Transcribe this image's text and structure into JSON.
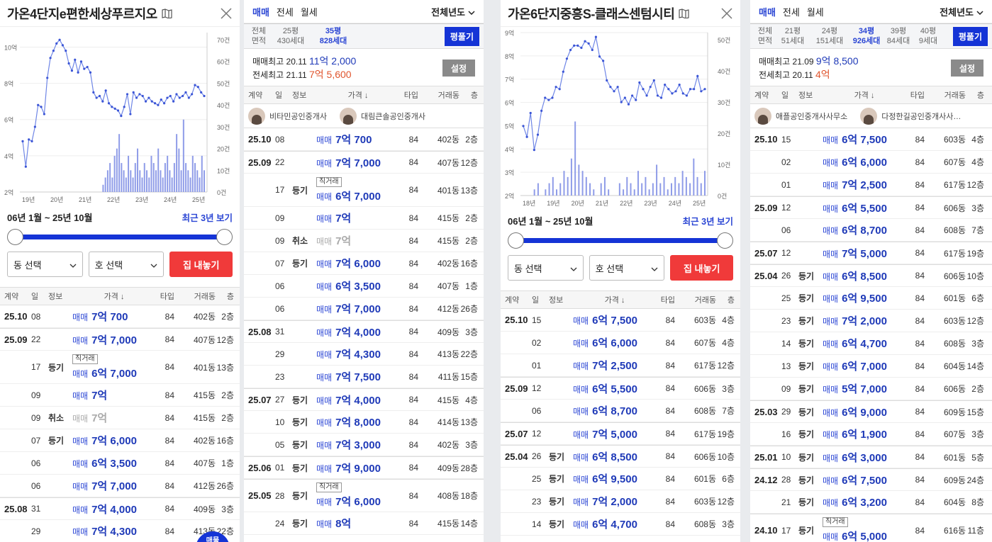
{
  "p1": {
    "title": "가온4단지e편한세상푸르지오",
    "chart_data": {
      "type": "line",
      "x_ticks": [
        "19년",
        "20년",
        "21년",
        "22년",
        "23년",
        "24년",
        "25년"
      ],
      "y_left_ticks": [
        "10억",
        "8억",
        "6억",
        "4억",
        "2억"
      ],
      "y_right_ticks": [
        "70건",
        "60건",
        "50건",
        "40건",
        "30건",
        "20건",
        "10건",
        "0건"
      ],
      "series": [
        {
          "values": [
            4.8,
            3.4,
            4.9,
            4.8,
            5.6,
            6.8,
            6.7,
            6.3,
            8.3,
            9.4,
            9.8,
            10.2,
            10.4,
            10.1,
            9.8,
            9.1,
            8.7,
            9.3,
            8.6,
            9.2,
            8.8,
            8.9,
            8.6,
            7.5,
            7.2,
            7.3,
            7.0,
            7.6,
            6.9,
            6.7,
            6.6,
            6.5,
            6.2,
            6.7,
            7.4,
            6.3,
            7.5,
            7.2,
            7.4,
            7.3,
            7.0,
            7.2,
            7.0,
            6.9,
            6.8,
            7.1,
            6.9,
            7.2,
            7.3,
            7.0,
            7.4,
            7.2,
            7.3,
            7.5,
            7.2,
            7.4,
            7.9,
            7.8,
            7.5,
            7.3
          ]
        },
        {
          "type": "bar",
          "values": [
            0,
            0,
            0,
            0,
            0,
            0,
            0,
            0,
            0,
            0,
            0,
            0,
            0,
            0,
            0,
            0,
            0,
            0,
            0,
            0,
            0,
            0,
            0,
            0,
            0,
            0,
            0,
            0,
            0,
            0,
            0,
            0,
            0,
            0,
            0,
            1,
            2,
            3,
            4,
            2,
            5,
            6,
            8,
            4,
            3,
            2,
            5,
            3,
            2,
            4,
            6,
            3,
            2,
            4,
            3,
            2,
            5,
            4,
            3,
            6,
            3,
            2,
            4,
            5,
            3,
            2,
            4,
            8,
            6,
            3,
            10,
            4,
            3,
            2,
            5,
            4,
            3,
            2,
            5,
            3
          ]
        }
      ],
      "ylim": [
        2,
        10.8
      ]
    },
    "range_label": "06년 1월 ~ 25년 10월",
    "recent_btn": "최근 3년 보기",
    "dong_select": "동 선택",
    "ho_select": "호 선택",
    "red_btn": "집 내놓기",
    "th": {
      "c1": "계약",
      "c2": "일",
      "c3": "정보",
      "c4": "가격",
      "c5": "타입",
      "c6": "거래동",
      "c7": "층"
    },
    "rows": [
      {
        "m": "25.10",
        "d": "08",
        "info": "",
        "tag": "",
        "k": "매매",
        "v": "7억 700",
        "t": "84",
        "dong": "402동",
        "f": "2층"
      },
      {
        "m": "25.09",
        "d": "22",
        "info": "",
        "tag": "",
        "k": "매매",
        "v": "7억 7,000",
        "t": "84",
        "dong": "407동",
        "f": "12층"
      },
      {
        "m": "",
        "d": "17",
        "info": "등기",
        "tag": "직거래",
        "k": "매매",
        "v": "6억 7,000",
        "t": "84",
        "dong": "401동",
        "f": "13층"
      },
      {
        "m": "",
        "d": "09",
        "info": "",
        "tag": "",
        "k": "매매",
        "v": "7억",
        "t": "84",
        "dong": "415동",
        "f": "2층"
      },
      {
        "m": "",
        "d": "09",
        "info": "취소",
        "tag": "",
        "k": "매매",
        "v": "7억",
        "t": "84",
        "dong": "415동",
        "f": "2층",
        "cancel": true
      },
      {
        "m": "",
        "d": "07",
        "info": "등기",
        "tag": "",
        "k": "매매",
        "v": "7억 6,000",
        "t": "84",
        "dong": "402동",
        "f": "16층"
      },
      {
        "m": "",
        "d": "06",
        "info": "",
        "tag": "",
        "k": "매매",
        "v": "6억 3,500",
        "t": "84",
        "dong": "407동",
        "f": "1층"
      },
      {
        "m": "",
        "d": "06",
        "info": "",
        "tag": "",
        "k": "매매",
        "v": "7억 7,000",
        "t": "84",
        "dong": "412동",
        "f": "26층"
      },
      {
        "m": "25.08",
        "d": "31",
        "info": "",
        "tag": "",
        "k": "매매",
        "v": "7억 4,000",
        "t": "84",
        "dong": "409동",
        "f": "3층"
      },
      {
        "m": "",
        "d": "29",
        "info": "",
        "tag": "",
        "k": "매매",
        "v": "7억 4,300",
        "t": "84",
        "dong": "413동",
        "f": "22층"
      }
    ],
    "fab": "매물"
  },
  "p2": {
    "tabs": [
      "매매",
      "전세",
      "월세"
    ],
    "year_sel": "전체년도",
    "areas": [
      {
        "a": "전체",
        "b": "면적"
      },
      {
        "a": "25평",
        "b": "430세대"
      },
      {
        "a": "35평",
        "b": "828세대",
        "on": true
      }
    ],
    "pyeong_btn": "평풀기",
    "sale_high_label": "매매최고",
    "sale_high_date": "20.11",
    "sale_high_val": "11억 2,000",
    "rent_high_label": "전세최고",
    "rent_high_date": "21.11",
    "rent_high_val": "7억 5,600",
    "setting_btn": "설정",
    "th": {
      "c1": "계약",
      "c2": "일",
      "c3": "정보",
      "c4": "가격",
      "c5": "타입",
      "c6": "거래동",
      "c7": "층"
    },
    "agents": [
      "비타민공인중개사",
      "대림큰솔공인중개사"
    ],
    "rows": [
      {
        "m": "25.10",
        "d": "08",
        "info": "",
        "tag": "",
        "k": "매매",
        "v": "7억 700",
        "t": "84",
        "dong": "402동",
        "f": "2층"
      },
      {
        "m": "25.09",
        "d": "22",
        "info": "",
        "tag": "",
        "k": "매매",
        "v": "7억 7,000",
        "t": "84",
        "dong": "407동",
        "f": "12층"
      },
      {
        "m": "",
        "d": "17",
        "info": "등기",
        "tag": "직거래",
        "k": "매매",
        "v": "6억 7,000",
        "t": "84",
        "dong": "401동",
        "f": "13층"
      },
      {
        "m": "",
        "d": "09",
        "info": "",
        "tag": "",
        "k": "매매",
        "v": "7억",
        "t": "84",
        "dong": "415동",
        "f": "2층"
      },
      {
        "m": "",
        "d": "09",
        "info": "취소",
        "tag": "",
        "k": "매매",
        "v": "7억",
        "t": "84",
        "dong": "415동",
        "f": "2층",
        "cancel": true
      },
      {
        "m": "",
        "d": "07",
        "info": "등기",
        "tag": "",
        "k": "매매",
        "v": "7억 6,000",
        "t": "84",
        "dong": "402동",
        "f": "16층"
      },
      {
        "m": "",
        "d": "06",
        "info": "",
        "tag": "",
        "k": "매매",
        "v": "6억 3,500",
        "t": "84",
        "dong": "407동",
        "f": "1층"
      },
      {
        "m": "",
        "d": "06",
        "info": "",
        "tag": "",
        "k": "매매",
        "v": "7억 7,000",
        "t": "84",
        "dong": "412동",
        "f": "26층"
      },
      {
        "m": "25.08",
        "d": "31",
        "info": "",
        "tag": "",
        "k": "매매",
        "v": "7억 4,000",
        "t": "84",
        "dong": "409동",
        "f": "3층"
      },
      {
        "m": "",
        "d": "29",
        "info": "",
        "tag": "",
        "k": "매매",
        "v": "7억 4,300",
        "t": "84",
        "dong": "413동",
        "f": "22층"
      },
      {
        "m": "",
        "d": "23",
        "info": "",
        "tag": "",
        "k": "매매",
        "v": "7억 7,500",
        "t": "84",
        "dong": "411동",
        "f": "15층"
      },
      {
        "m": "25.07",
        "d": "27",
        "info": "등기",
        "tag": "",
        "k": "매매",
        "v": "7억 4,000",
        "t": "84",
        "dong": "415동",
        "f": "4층"
      },
      {
        "m": "",
        "d": "10",
        "info": "등기",
        "tag": "",
        "k": "매매",
        "v": "7억 8,000",
        "t": "84",
        "dong": "414동",
        "f": "13층"
      },
      {
        "m": "",
        "d": "05",
        "info": "등기",
        "tag": "",
        "k": "매매",
        "v": "7억 3,000",
        "t": "84",
        "dong": "402동",
        "f": "3층"
      },
      {
        "m": "25.06",
        "d": "01",
        "info": "등기",
        "tag": "",
        "k": "매매",
        "v": "7억 9,000",
        "t": "84",
        "dong": "409동",
        "f": "28층"
      },
      {
        "m": "25.05",
        "d": "28",
        "info": "등기",
        "tag": "직거래",
        "k": "매매",
        "v": "7억 6,000",
        "t": "84",
        "dong": "408동",
        "f": "18층"
      },
      {
        "m": "",
        "d": "24",
        "info": "등기",
        "tag": "",
        "k": "매매",
        "v": "8억",
        "t": "84",
        "dong": "415동",
        "f": "14층"
      }
    ]
  },
  "p3": {
    "title": "가온6단지중흥S-클래스센텀시티",
    "chart_data": {
      "type": "line",
      "x_ticks": [
        "18년",
        "19년",
        "20년",
        "21년",
        "22년",
        "23년",
        "24년",
        "25년"
      ],
      "y_left_ticks": [
        "9억",
        "8억",
        "7억",
        "6억",
        "5억",
        "4억",
        "3억",
        "2억"
      ],
      "y_right_ticks": [
        "50건",
        "40건",
        "30건",
        "20건",
        "10건",
        "0건"
      ],
      "series": [
        {
          "values": [
            5.2,
            4.7,
            5.8,
            4.1,
            4.8,
            5.9,
            6.5,
            6.4,
            6.5,
            7.0,
            6.9,
            7.7,
            8.3,
            8.7,
            8.9,
            8.9,
            8.8,
            9.1,
            9.0,
            8.7,
            9.3,
            8.4,
            8.2,
            7.3,
            7.0,
            6.8,
            7.0,
            6.3,
            6.5,
            6.2,
            6.6,
            6.4,
            7.2,
            6.9,
            6.6,
            7.0,
            7.3,
            6.6,
            6.5,
            7.1,
            6.9,
            6.7,
            6.8,
            7.1,
            6.7,
            6.6,
            6.9,
            6.9,
            7.5,
            6.8,
            6.9
          ]
        },
        {
          "type": "bar",
          "values": [
            0,
            0,
            0,
            1,
            2,
            0,
            1,
            2,
            3,
            1,
            2,
            4,
            3,
            6,
            12,
            5,
            4,
            3,
            2,
            1,
            0,
            2,
            3,
            1,
            0,
            0,
            2,
            1,
            3,
            2,
            1,
            4,
            2,
            3,
            1,
            2,
            5,
            2,
            3,
            1,
            2,
            3,
            2,
            4,
            3,
            2,
            6,
            3,
            2,
            4
          ]
        }
      ],
      "ylim": [
        2,
        9.5
      ]
    },
    "range_label": "06년 1월 ~ 25년 10월",
    "recent_btn": "최근 3년 보기",
    "dong_select": "동 선택",
    "ho_select": "호 선택",
    "red_btn": "집 내놓기",
    "th": {
      "c1": "계약",
      "c2": "일",
      "c3": "정보",
      "c4": "가격",
      "c5": "타입",
      "c6": "거래동",
      "c7": "층"
    },
    "rows": [
      {
        "m": "25.10",
        "d": "15",
        "info": "",
        "tag": "",
        "k": "매매",
        "v": "6억 7,500",
        "t": "84",
        "dong": "603동",
        "f": "4층"
      },
      {
        "m": "",
        "d": "02",
        "info": "",
        "tag": "",
        "k": "매매",
        "v": "6억 6,000",
        "t": "84",
        "dong": "607동",
        "f": "4층"
      },
      {
        "m": "",
        "d": "01",
        "info": "",
        "tag": "",
        "k": "매매",
        "v": "7억 2,500",
        "t": "84",
        "dong": "617동",
        "f": "12층"
      },
      {
        "m": "25.09",
        "d": "12",
        "info": "",
        "tag": "",
        "k": "매매",
        "v": "6억 5,500",
        "t": "84",
        "dong": "606동",
        "f": "3층"
      },
      {
        "m": "",
        "d": "06",
        "info": "",
        "tag": "",
        "k": "매매",
        "v": "6억 8,700",
        "t": "84",
        "dong": "608동",
        "f": "7층"
      },
      {
        "m": "25.07",
        "d": "12",
        "info": "",
        "tag": "",
        "k": "매매",
        "v": "7억 5,000",
        "t": "84",
        "dong": "617동",
        "f": "19층"
      },
      {
        "m": "25.04",
        "d": "26",
        "info": "등기",
        "tag": "",
        "k": "매매",
        "v": "6억 8,500",
        "t": "84",
        "dong": "606동",
        "f": "10층"
      },
      {
        "m": "",
        "d": "25",
        "info": "등기",
        "tag": "",
        "k": "매매",
        "v": "6억 9,500",
        "t": "84",
        "dong": "601동",
        "f": "6층"
      },
      {
        "m": "",
        "d": "23",
        "info": "등기",
        "tag": "",
        "k": "매매",
        "v": "7억 2,000",
        "t": "84",
        "dong": "603동",
        "f": "12층"
      },
      {
        "m": "",
        "d": "14",
        "info": "등기",
        "tag": "",
        "k": "매매",
        "v": "6억 4,700",
        "t": "84",
        "dong": "608동",
        "f": "3층"
      }
    ]
  },
  "p4": {
    "tabs": [
      "매매",
      "전세",
      "월세"
    ],
    "year_sel": "전체년도",
    "areas": [
      {
        "a": "전체",
        "b": "면적"
      },
      {
        "a": "21평",
        "b": "51세대"
      },
      {
        "a": "24평",
        "b": "151세대"
      },
      {
        "a": "34평",
        "b": "926세대",
        "on": true
      },
      {
        "a": "39평",
        "b": "84세대"
      },
      {
        "a": "40평",
        "b": "9세대"
      }
    ],
    "pyeong_btn": "평풀기",
    "sale_high_label": "매매최고",
    "sale_high_date": "21.09",
    "sale_high_val": "9억 8,500",
    "rent_high_label": "전세최고",
    "rent_high_date": "20.11",
    "rent_high_val": "4억",
    "setting_btn": "설정",
    "th": {
      "c1": "계약",
      "c2": "일",
      "c3": "정보",
      "c4": "가격",
      "c5": "타입",
      "c6": "거래동",
      "c7": "층"
    },
    "agents": [
      "애플공인중개사사무소",
      "다정한길공인중개사사…"
    ],
    "rows": [
      {
        "m": "25.10",
        "d": "15",
        "info": "",
        "tag": "",
        "k": "매매",
        "v": "6억 7,500",
        "t": "84",
        "dong": "603동",
        "f": "4층"
      },
      {
        "m": "",
        "d": "02",
        "info": "",
        "tag": "",
        "k": "매매",
        "v": "6억 6,000",
        "t": "84",
        "dong": "607동",
        "f": "4층"
      },
      {
        "m": "",
        "d": "01",
        "info": "",
        "tag": "",
        "k": "매매",
        "v": "7억 2,500",
        "t": "84",
        "dong": "617동",
        "f": "12층"
      },
      {
        "m": "25.09",
        "d": "12",
        "info": "",
        "tag": "",
        "k": "매매",
        "v": "6억 5,500",
        "t": "84",
        "dong": "606동",
        "f": "3층"
      },
      {
        "m": "",
        "d": "06",
        "info": "",
        "tag": "",
        "k": "매매",
        "v": "6억 8,700",
        "t": "84",
        "dong": "608동",
        "f": "7층"
      },
      {
        "m": "25.07",
        "d": "12",
        "info": "",
        "tag": "",
        "k": "매매",
        "v": "7억 5,000",
        "t": "84",
        "dong": "617동",
        "f": "19층"
      },
      {
        "m": "25.04",
        "d": "26",
        "info": "등기",
        "tag": "",
        "k": "매매",
        "v": "6억 8,500",
        "t": "84",
        "dong": "606동",
        "f": "10층"
      },
      {
        "m": "",
        "d": "25",
        "info": "등기",
        "tag": "",
        "k": "매매",
        "v": "6억 9,500",
        "t": "84",
        "dong": "601동",
        "f": "6층"
      },
      {
        "m": "",
        "d": "23",
        "info": "등기",
        "tag": "",
        "k": "매매",
        "v": "7억 2,000",
        "t": "84",
        "dong": "603동",
        "f": "12층"
      },
      {
        "m": "",
        "d": "14",
        "info": "등기",
        "tag": "",
        "k": "매매",
        "v": "6억 4,700",
        "t": "84",
        "dong": "608동",
        "f": "3층"
      },
      {
        "m": "",
        "d": "13",
        "info": "등기",
        "tag": "",
        "k": "매매",
        "v": "6억 7,000",
        "t": "84",
        "dong": "604동",
        "f": "14층"
      },
      {
        "m": "",
        "d": "09",
        "info": "등기",
        "tag": "",
        "k": "매매",
        "v": "5억 7,000",
        "t": "84",
        "dong": "606동",
        "f": "2층"
      },
      {
        "m": "25.03",
        "d": "29",
        "info": "등기",
        "tag": "",
        "k": "매매",
        "v": "6억 9,000",
        "t": "84",
        "dong": "609동",
        "f": "15층"
      },
      {
        "m": "",
        "d": "16",
        "info": "등기",
        "tag": "",
        "k": "매매",
        "v": "6억 1,900",
        "t": "84",
        "dong": "607동",
        "f": "3층"
      },
      {
        "m": "25.01",
        "d": "10",
        "info": "등기",
        "tag": "",
        "k": "매매",
        "v": "6억 3,000",
        "t": "84",
        "dong": "601동",
        "f": "5층"
      },
      {
        "m": "24.12",
        "d": "28",
        "info": "등기",
        "tag": "",
        "k": "매매",
        "v": "6억 7,500",
        "t": "84",
        "dong": "609동",
        "f": "24층"
      },
      {
        "m": "",
        "d": "21",
        "info": "등기",
        "tag": "",
        "k": "매매",
        "v": "6억 3,200",
        "t": "84",
        "dong": "604동",
        "f": "8층"
      },
      {
        "m": "24.10",
        "d": "17",
        "info": "등기",
        "tag": "직거래",
        "k": "매매",
        "v": "6억 5,000",
        "t": "84",
        "dong": "616동",
        "f": "11층"
      }
    ]
  }
}
